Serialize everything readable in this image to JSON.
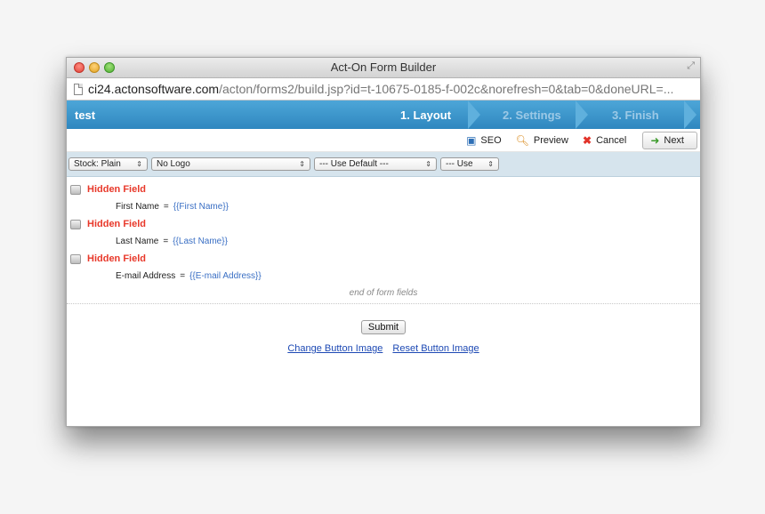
{
  "window": {
    "title": "Act-On Form Builder"
  },
  "address": {
    "host": "ci24.actonsoftware.com",
    "path": "/acton/forms2/build.jsp?id=t-10675-0185-f-002c&norefresh=0&tab=0&doneURL=..."
  },
  "wizard": {
    "title": "test",
    "steps": [
      {
        "label": "1. Layout",
        "active": true
      },
      {
        "label": "2. Settings",
        "active": false
      },
      {
        "label": "3. Finish",
        "active": false
      }
    ]
  },
  "toolbar": {
    "seo": "SEO",
    "preview": "Preview",
    "cancel": "Cancel",
    "next": "Next"
  },
  "options": {
    "style": "Stock: Plain",
    "logo": "No Logo",
    "default": "--- Use Default ---",
    "use": "--- Use"
  },
  "fields": [
    {
      "type": "Hidden Field",
      "name": "First Name",
      "token": "{{First Name}}"
    },
    {
      "type": "Hidden Field",
      "name": "Last Name",
      "token": "{{Last Name}}"
    },
    {
      "type": "Hidden Field",
      "name": "E-mail Address",
      "token": "{{E-mail Address}}"
    }
  ],
  "end_label": "end of form fields",
  "submit": "Submit",
  "links": {
    "change": "Change Button Image",
    "reset": "Reset Button Image"
  },
  "colors": {
    "wizard_bar": "#3a95cc",
    "hidden_label": "#e8382a",
    "token": "#3a6fc4",
    "link": "#1d49b4"
  }
}
